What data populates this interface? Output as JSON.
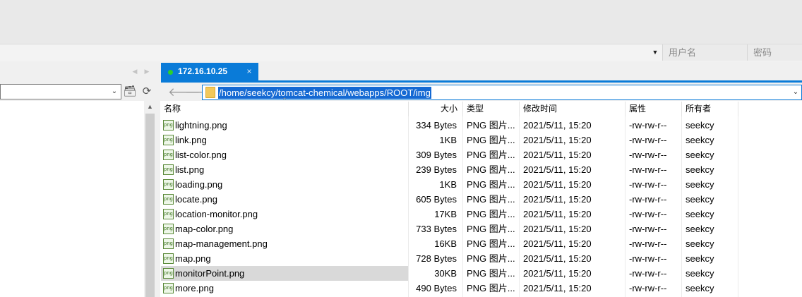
{
  "login": {
    "username_placeholder": "用户名",
    "password_placeholder": "密码",
    "dropdown_icon": "caret-down-icon"
  },
  "tab": {
    "title": "172.16.10.25",
    "close": "×",
    "status_color": "#2bd12b",
    "accent_color": "#0a7bd8"
  },
  "path": {
    "value": "/home/seekcy/tomcat-chemical/webapps/ROOT/img"
  },
  "columns": {
    "name": "名称",
    "size": "大小",
    "type": "类型",
    "modified": "修改时间",
    "attrs": "属性",
    "owner": "所有者"
  },
  "files": [
    {
      "icon": "png",
      "name": "lightning.png",
      "size": "334 Bytes",
      "type": "PNG 图片...",
      "modified": "2021/5/11, 15:20",
      "perm": "-rw-rw-r--",
      "owner": "seekcy"
    },
    {
      "icon": "png",
      "name": "link.png",
      "size": "1KB",
      "type": "PNG 图片...",
      "modified": "2021/5/11, 15:20",
      "perm": "-rw-rw-r--",
      "owner": "seekcy"
    },
    {
      "icon": "png",
      "name": "list-color.png",
      "size": "309 Bytes",
      "type": "PNG 图片...",
      "modified": "2021/5/11, 15:20",
      "perm": "-rw-rw-r--",
      "owner": "seekcy"
    },
    {
      "icon": "png",
      "name": "list.png",
      "size": "239 Bytes",
      "type": "PNG 图片...",
      "modified": "2021/5/11, 15:20",
      "perm": "-rw-rw-r--",
      "owner": "seekcy"
    },
    {
      "icon": "png",
      "name": "loading.png",
      "size": "1KB",
      "type": "PNG 图片...",
      "modified": "2021/5/11, 15:20",
      "perm": "-rw-rw-r--",
      "owner": "seekcy"
    },
    {
      "icon": "png",
      "name": "locate.png",
      "size": "605 Bytes",
      "type": "PNG 图片...",
      "modified": "2021/5/11, 15:20",
      "perm": "-rw-rw-r--",
      "owner": "seekcy"
    },
    {
      "icon": "png",
      "name": "location-monitor.png",
      "size": "17KB",
      "type": "PNG 图片...",
      "modified": "2021/5/11, 15:20",
      "perm": "-rw-rw-r--",
      "owner": "seekcy"
    },
    {
      "icon": "png",
      "name": "map-color.png",
      "size": "733 Bytes",
      "type": "PNG 图片...",
      "modified": "2021/5/11, 15:20",
      "perm": "-rw-rw-r--",
      "owner": "seekcy"
    },
    {
      "icon": "png",
      "name": "map-management.png",
      "size": "16KB",
      "type": "PNG 图片...",
      "modified": "2021/5/11, 15:20",
      "perm": "-rw-rw-r--",
      "owner": "seekcy"
    },
    {
      "icon": "png",
      "name": "map.png",
      "size": "728 Bytes",
      "type": "PNG 图片...",
      "modified": "2021/5/11, 15:20",
      "perm": "-rw-rw-r--",
      "owner": "seekcy"
    },
    {
      "icon": "png",
      "name": "monitorPoint.png",
      "size": "30KB",
      "type": "PNG 图片...",
      "modified": "2021/5/11, 15:20",
      "perm": "-rw-rw-r--",
      "owner": "seekcy"
    },
    {
      "icon": "png",
      "name": "more.png",
      "size": "490 Bytes",
      "type": "PNG 图片...",
      "modified": "2021/5/11, 15:20",
      "perm": "-rw-rw-r--",
      "owner": "seekcy"
    }
  ],
  "selected_file": "monitorPoint.png"
}
